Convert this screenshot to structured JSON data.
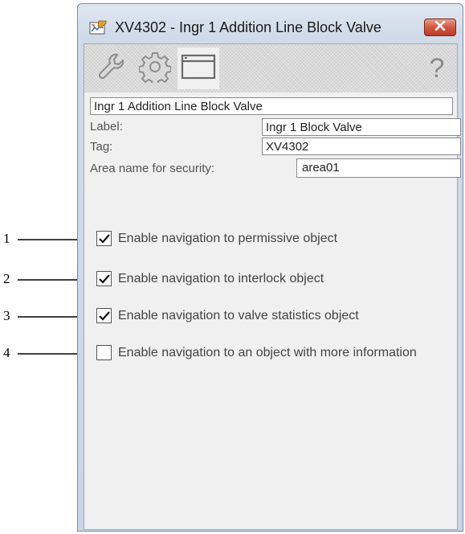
{
  "window": {
    "title": "XV4302 - Ingr 1 Addition Line Block Valve"
  },
  "toolbar": {
    "tabs": [
      {
        "icon": "wrench-icon"
      },
      {
        "icon": "gear-icon"
      },
      {
        "icon": "window-icon",
        "active": true
      }
    ],
    "help_label": "?"
  },
  "form": {
    "description_value": "Ingr 1 Addition Line Block Valve",
    "label_caption": "Label:",
    "label_value": "Ingr 1 Block Valve",
    "tag_caption": "Tag:",
    "tag_value": "XV4302",
    "area_caption": "Area name for security:",
    "area_value": "area01"
  },
  "options": [
    {
      "label": "Enable navigation to permissive object",
      "checked": true
    },
    {
      "label": "Enable navigation to interlock object",
      "checked": true
    },
    {
      "label": "Enable navigation to valve statistics object",
      "checked": true
    },
    {
      "label": "Enable navigation to an object with more information",
      "checked": false
    }
  ],
  "callouts": [
    "1",
    "2",
    "3",
    "4"
  ],
  "colors": {
    "close_button": "#c0392b",
    "window_frame": "#cfdbe9",
    "toolbar": "#d8d8d8"
  }
}
